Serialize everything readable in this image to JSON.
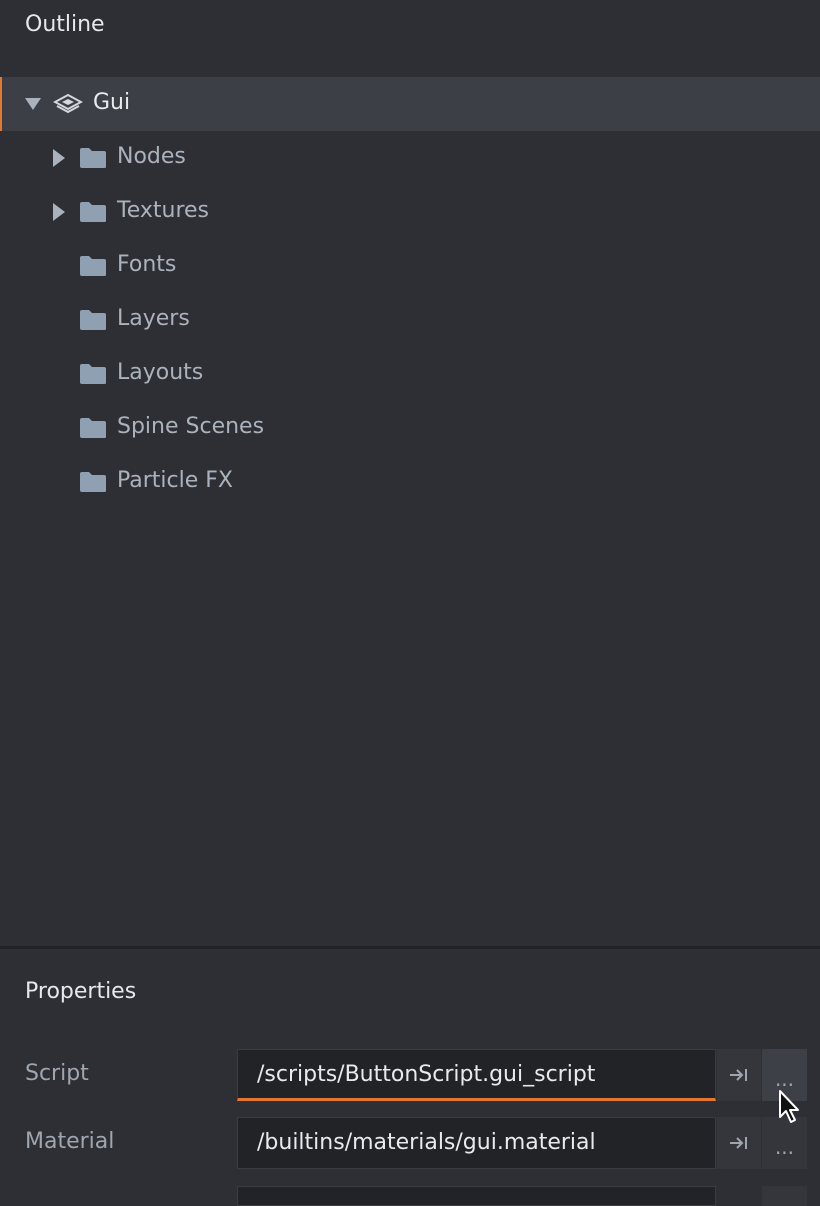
{
  "outline": {
    "title": "Outline",
    "root": {
      "label": "Gui",
      "expanded": true,
      "selected": true,
      "icon": "layers-icon"
    },
    "children": [
      {
        "label": "Nodes",
        "expandable": true,
        "icon": "folder-icon"
      },
      {
        "label": "Textures",
        "expandable": true,
        "icon": "folder-icon"
      },
      {
        "label": "Fonts",
        "expandable": false,
        "icon": "folder-icon"
      },
      {
        "label": "Layers",
        "expandable": false,
        "icon": "folder-icon"
      },
      {
        "label": "Layouts",
        "expandable": false,
        "icon": "folder-icon"
      },
      {
        "label": "Spine Scenes",
        "expandable": false,
        "icon": "folder-icon"
      },
      {
        "label": "Particle FX",
        "expandable": false,
        "icon": "folder-icon"
      }
    ]
  },
  "properties": {
    "title": "Properties",
    "fields": [
      {
        "label": "Script",
        "value": "/scripts/ButtonScript.gui_script",
        "goto_icon": "goto-arrow-icon",
        "more_label": "..."
      },
      {
        "label": "Material",
        "value": "/builtins/materials/gui.material",
        "goto_icon": "goto-arrow-icon",
        "more_label": "..."
      }
    ]
  },
  "colors": {
    "accent": "#e5782f",
    "background": "#2e2f34",
    "selection": "#3c3f45",
    "folder": "#8fa0b3"
  }
}
